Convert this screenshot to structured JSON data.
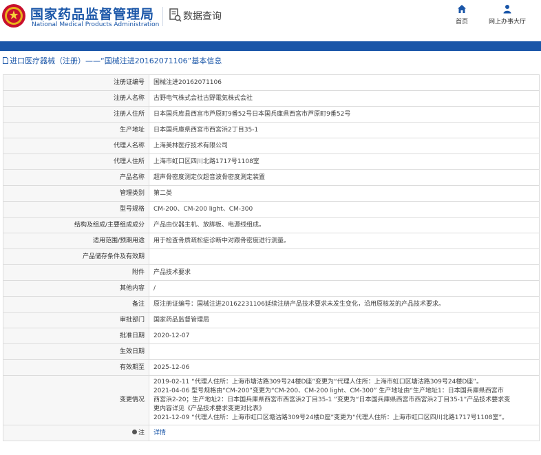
{
  "header": {
    "brand_cn": "国家药品监督管理局",
    "brand_en": "National Medical Products Administration",
    "query_label": "数据查询",
    "nav": [
      {
        "label": "首页",
        "icon": "home-icon"
      },
      {
        "label": "网上办事大厅",
        "icon": "user-icon"
      }
    ],
    "accent_color": "#1a56a8"
  },
  "title": "进口医疗器械（注册）——“国械注进20162071106”基本信息",
  "rows": [
    {
      "label": "注册证编号",
      "value": "国械注进20162071106"
    },
    {
      "label": "注册人名称",
      "value": "古野电气株式会社古野電気株式会社"
    },
    {
      "label": "注册人住所",
      "value": "日本国兵库县西宫市芦原町9番52号日本国兵庫県西宮市芦原町9番52号"
    },
    {
      "label": "生产地址",
      "value": "日本国兵庫県西宮市西宮浜2丁目35-1"
    },
    {
      "label": "代理人名称",
      "value": "上海美林医疗技术有限公司"
    },
    {
      "label": "代理人住所",
      "value": "上海市虹口区四川北路1717号1108室"
    },
    {
      "label": "产品名称",
      "value": "超声骨密度测定仪超音波骨密度測定装置"
    },
    {
      "label": "管理类别",
      "value": "第二类"
    },
    {
      "label": "型号规格",
      "value": "CM-200、CM-200 light、CM-300"
    },
    {
      "label": "结构及组成/主要组成成分",
      "value": "产品由仪器主机、放脚板、电源线组成。"
    },
    {
      "label": "适用范围/预期用途",
      "value": "用于检查骨质疏松症诊断中对跟骨密度进行测量。"
    },
    {
      "label": "产品储存条件及有效期",
      "value": ""
    },
    {
      "label": "附件",
      "value": "产品技术要求"
    },
    {
      "label": "其他内容",
      "value": "/"
    },
    {
      "label": "备注",
      "value": "原注册证编号：国械注进20162231106延续注册产品技术要求未发生变化，沿用原核发的产品技术要求。"
    },
    {
      "label": "审批部门",
      "value": "国家药品监督管理局"
    },
    {
      "label": "批准日期",
      "value": "2020-12-07"
    },
    {
      "label": "生效日期",
      "value": ""
    },
    {
      "label": "有效期至",
      "value": "2025-12-06"
    }
  ],
  "changes": {
    "label": "变更情况",
    "lines": [
      "2019-02-11 “代理人住所：上海市塘沽路309号24楼D座”变更为“代理人住所：上海市虹口区塘沽路309号24楼D座”。",
      "2021-04-06 型号规格由“CM-200”变更为“CM-200、CM-200 light、CM-300” 生产地址由“生产地址1：日本国兵庫県西宮市",
      "西宮浜2-20；生产地址2：日本国兵庫県西宮市西宮浜2丁目35-1 ”变更为“日本国兵庫県西宮市西宮浜2丁目35-1”产品技术要求变",
      "更内容详见《产品技术要求变更对比表》",
      "2021-12-09 “代理人住所：上海市虹口区塘沽路309号24楼D座”变更为“代理人住所：上海市虹口区四川北路1717号1108室”。"
    ]
  },
  "note": {
    "label": "注",
    "link": "详情"
  }
}
